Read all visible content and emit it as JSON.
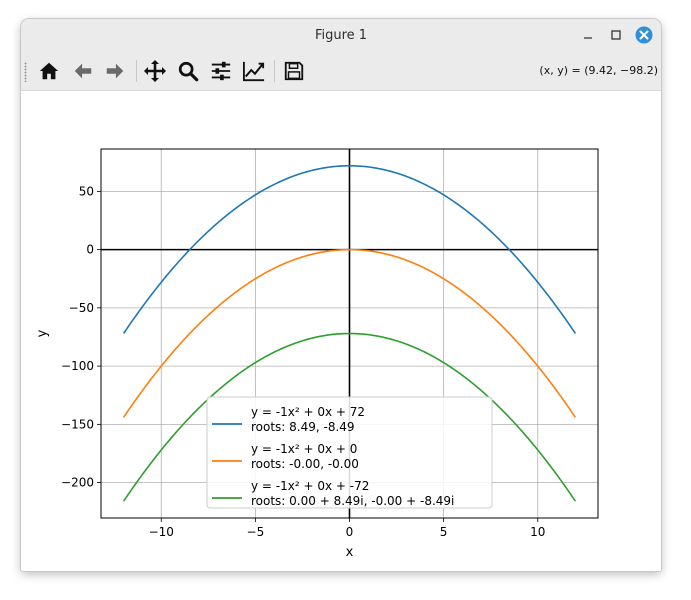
{
  "window": {
    "title": "Figure 1",
    "controls": [
      "minimize",
      "maximize",
      "close"
    ]
  },
  "toolbar": {
    "buttons": [
      {
        "name": "home",
        "icon": "home-icon"
      },
      {
        "name": "back",
        "icon": "arrow-left-icon"
      },
      {
        "name": "forward",
        "icon": "arrow-right-icon"
      },
      {
        "name": "pan",
        "icon": "move-icon"
      },
      {
        "name": "zoom",
        "icon": "magnifier-icon"
      },
      {
        "name": "configure-subplots",
        "icon": "sliders-icon"
      },
      {
        "name": "edit-axis",
        "icon": "line-chart-icon"
      },
      {
        "name": "save",
        "icon": "floppy-disk-icon"
      }
    ],
    "coords": "(x, y) = (9.42, −98.2)"
  },
  "colors": {
    "close_button": "#2f8fd9",
    "series": [
      "#1f77b4",
      "#ff7f0e",
      "#2ca02c"
    ]
  },
  "chart_data": {
    "type": "line",
    "title": "",
    "xlabel": "x",
    "ylabel": "y",
    "xlim": [
      -13.2,
      13.2
    ],
    "ylim": [
      -230.4,
      86.4
    ],
    "x_ticks": [
      -10,
      -5,
      0,
      5,
      10
    ],
    "x_tick_labels": [
      "−10",
      "−5",
      "0",
      "5",
      "10"
    ],
    "y_ticks": [
      50,
      0,
      -50,
      -100,
      -150,
      -200
    ],
    "y_tick_labels": [
      "50",
      "0",
      "−50",
      "−100",
      "−150",
      "−200"
    ],
    "grid": true,
    "x_range": [
      -12,
      12
    ],
    "legend_position": "lower center",
    "series": [
      {
        "name": "y = -1x² + 0x + 72",
        "name2": "roots: 8.49, -8.49",
        "a": -1,
        "b": 0,
        "c": 72
      },
      {
        "name": "y = -1x² + 0x + 0",
        "name2": "roots: -0.00, -0.00",
        "a": -1,
        "b": 0,
        "c": 0
      },
      {
        "name": "y = -1x² + 0x + -72",
        "name2": "roots: 0.00 + 8.49i, -0.00 + -8.49i",
        "a": -1,
        "b": 0,
        "c": -72
      }
    ]
  }
}
